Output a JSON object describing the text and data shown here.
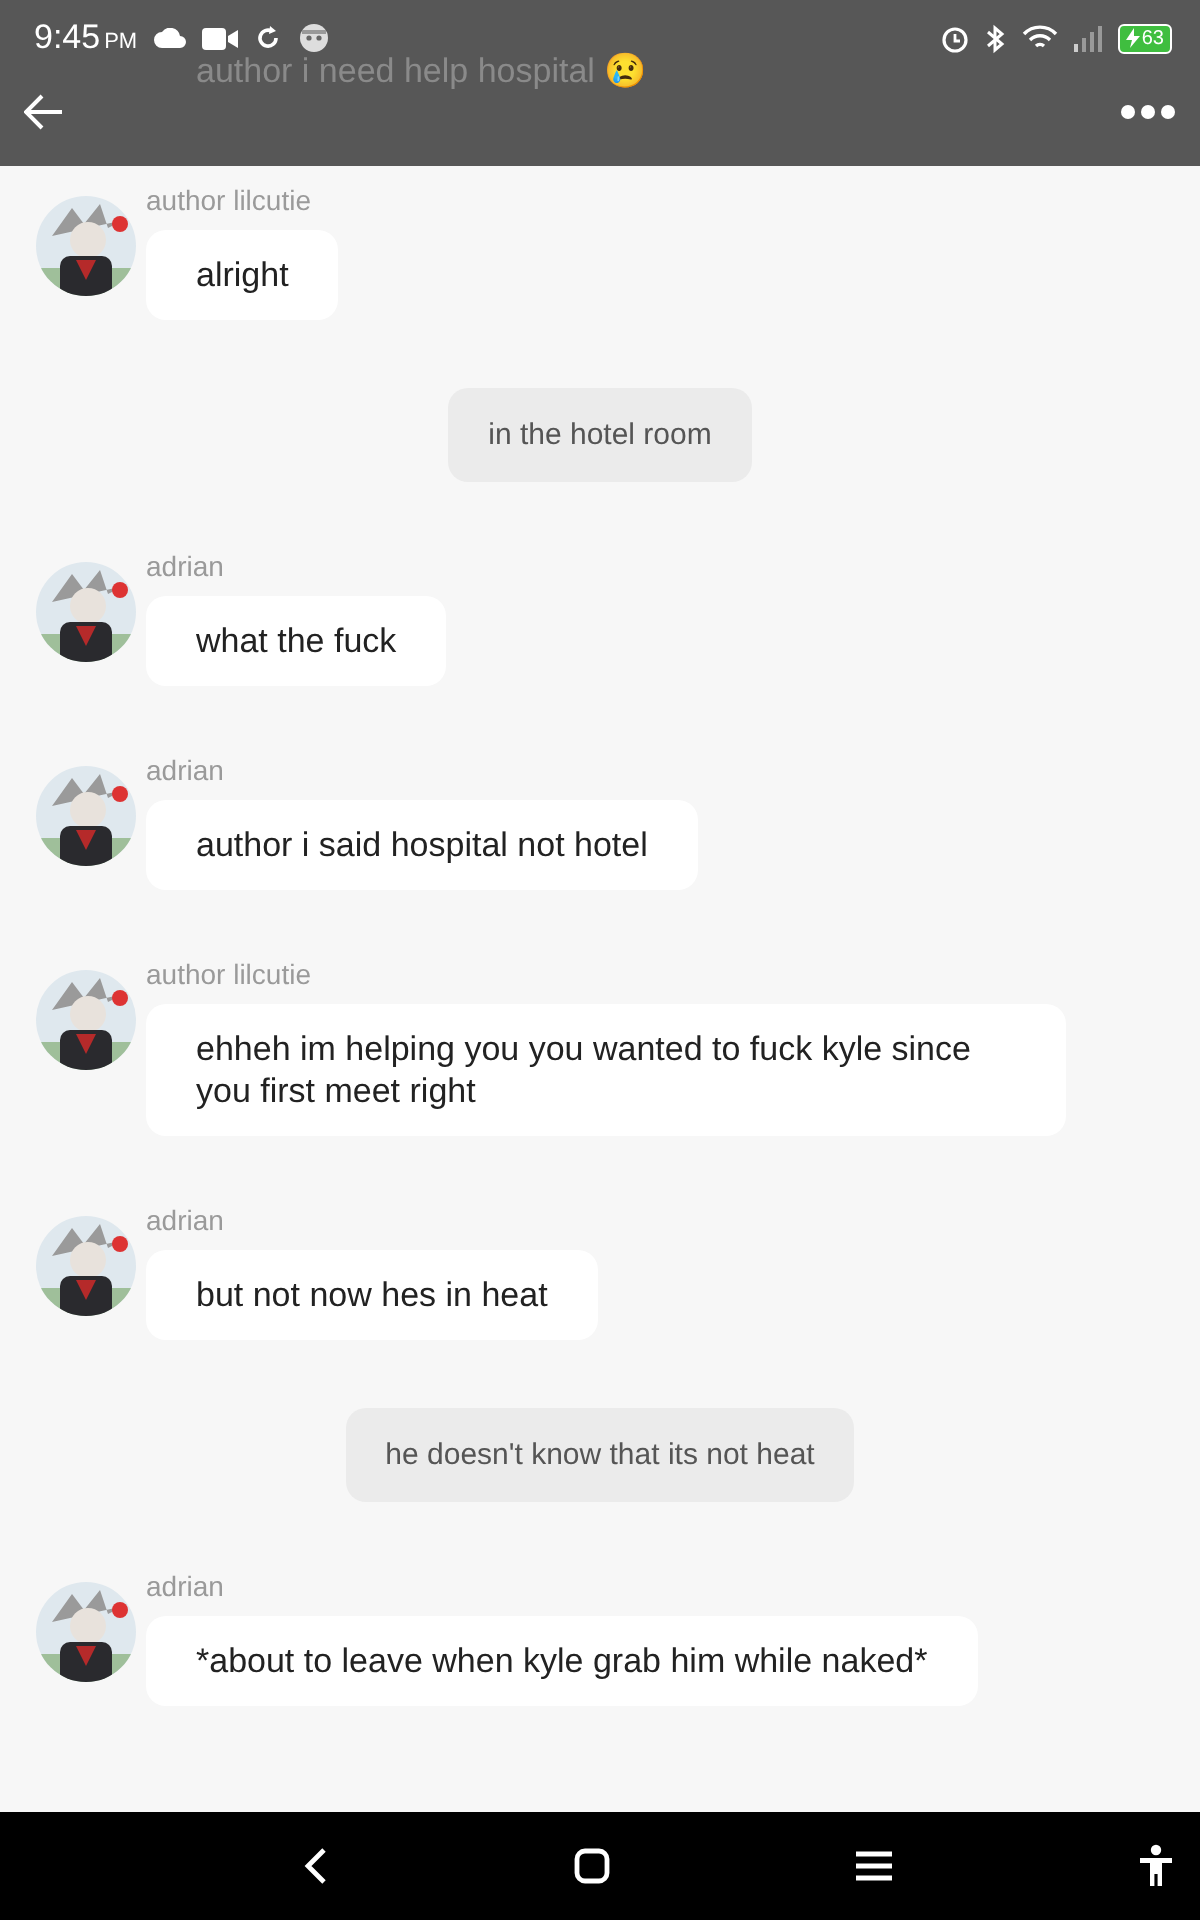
{
  "status_bar": {
    "time": "9:45",
    "ampm": "PM",
    "battery": "63"
  },
  "header": {
    "faded_message": "author i need help hospital 😢"
  },
  "messages": [
    {
      "kind": "message",
      "author": "author lilcutie",
      "text": "alright"
    },
    {
      "kind": "narration",
      "text": "in the hotel room"
    },
    {
      "kind": "message",
      "author": "adrian",
      "text": "what the fuck"
    },
    {
      "kind": "message",
      "author": "adrian",
      "text": "author i said hospital not hotel"
    },
    {
      "kind": "message",
      "author": "author lilcutie",
      "text": "ehheh im helping you you wanted to fuck kyle since you first meet right"
    },
    {
      "kind": "message",
      "author": "adrian",
      "text": "but not now hes in heat"
    },
    {
      "kind": "narration",
      "text": "he doesn't know that its not heat"
    },
    {
      "kind": "message",
      "author": "adrian",
      "text": "*about to leave when kyle grab him while naked*"
    }
  ]
}
